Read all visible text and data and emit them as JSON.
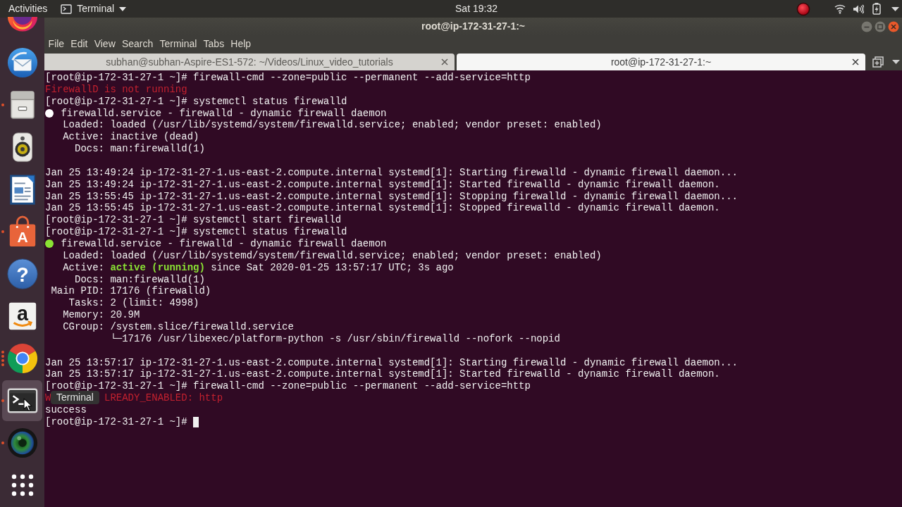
{
  "top_bar": {
    "activities": "Activities",
    "app_menu": "Terminal",
    "clock": "Sat 19:32"
  },
  "dock": {
    "items": [
      {
        "kind": "browser",
        "running": false,
        "hovered": false
      },
      {
        "kind": "mail",
        "running": false,
        "hovered": false
      },
      {
        "kind": "cabinet",
        "running": true,
        "several_windows": false,
        "hovered": false
      },
      {
        "kind": "speaker",
        "running": false,
        "hovered": false
      },
      {
        "kind": "document",
        "running": false,
        "hovered": false
      },
      {
        "kind": "bag",
        "glyph": "A",
        "running": true,
        "several_windows": false,
        "hovered": false
      },
      {
        "kind": "help",
        "glyph": "?",
        "running": false,
        "hovered": false
      },
      {
        "kind": "shop",
        "glyph": "a",
        "running": false,
        "hovered": false
      },
      {
        "kind": "wheel",
        "running": true,
        "several_windows": true,
        "hovered": false
      },
      {
        "kind": "terminal",
        "running": true,
        "several_windows": false,
        "hovered": true,
        "tooltip": "Terminal"
      },
      {
        "kind": "lens",
        "running": true,
        "several_windows": false,
        "hovered": false
      },
      {
        "kind": "grid",
        "running": false,
        "hovered": false
      }
    ]
  },
  "window": {
    "title": "root@ip-172-31-27-1:~",
    "menu": [
      "File",
      "Edit",
      "View",
      "Search",
      "Terminal",
      "Tabs",
      "Help"
    ],
    "tabs": [
      {
        "label": "subhan@subhan-Aspire-ES1-572: ~/Videos/Linux_video_tutorials",
        "selected": false
      },
      {
        "label": "root@ip-172-31-27-1:~",
        "selected": true
      }
    ]
  },
  "terminal": {
    "lines": [
      {
        "kind": "prompt",
        "text": "[root@ip-172-31-27-1 ~]# firewall-cmd --zone=public --permanent --add-service=http",
        "cursor": false
      },
      {
        "kind": "error",
        "parts": [
          "FirewallD is not running"
        ]
      },
      {
        "kind": "prompt",
        "text": "[root@ip-172-31-27-1 ~]# systemctl status firewalld",
        "cursor": false
      },
      {
        "kind": "unit",
        "color": "#ffffff",
        "text": "firewalld.service - firewalld - dynamic firewall daemon"
      },
      {
        "kind": "output",
        "text": "   Loaded: loaded (/usr/lib/systemd/system/firewalld.service; enabled; vendor preset: enabled)"
      },
      {
        "kind": "output",
        "text": "   Active: inactive (dead)"
      },
      {
        "kind": "output",
        "text": "     Docs: man:firewalld(1)"
      },
      {
        "kind": "blank"
      },
      {
        "kind": "output",
        "text": "Jan 25 13:49:24 ip-172-31-27-1.us-east-2.compute.internal systemd[1]: Starting firewalld - dynamic firewall daemon..."
      },
      {
        "kind": "output",
        "text": "Jan 25 13:49:24 ip-172-31-27-1.us-east-2.compute.internal systemd[1]: Started firewalld - dynamic firewall daemon."
      },
      {
        "kind": "output",
        "text": "Jan 25 13:55:45 ip-172-31-27-1.us-east-2.compute.internal systemd[1]: Stopping firewalld - dynamic firewall daemon..."
      },
      {
        "kind": "output",
        "text": "Jan 25 13:55:45 ip-172-31-27-1.us-east-2.compute.internal systemd[1]: Stopped firewalld - dynamic firewall daemon."
      },
      {
        "kind": "prompt",
        "text": "[root@ip-172-31-27-1 ~]# systemctl start firewalld",
        "cursor": false
      },
      {
        "kind": "prompt",
        "text": "[root@ip-172-31-27-1 ~]# systemctl status firewalld",
        "cursor": false
      },
      {
        "kind": "unit",
        "color": "#8ae234",
        "text": "firewalld.service - firewalld - dynamic firewall daemon"
      },
      {
        "kind": "output",
        "text": "   Loaded: loaded (/usr/lib/systemd/system/firewalld.service; enabled; vendor preset: enabled)"
      },
      {
        "kind": "output",
        "text": "   Active: **active (running)** since Sat 2020-01-25 13:57:17 UTC; 3s ago"
      },
      {
        "kind": "output",
        "text": "     Docs: man:firewalld(1)"
      },
      {
        "kind": "output",
        "text": " Main PID: 17176 (firewalld)"
      },
      {
        "kind": "output",
        "text": "    Tasks: 2 (limit: 4998)"
      },
      {
        "kind": "output",
        "text": "   Memory: 20.9M"
      },
      {
        "kind": "output",
        "text": "   CGroup: /system.slice/firewalld.service"
      },
      {
        "kind": "output",
        "text": "           └─17176 /usr/libexec/platform-python -s /usr/sbin/firewalld --nofork --nopid"
      },
      {
        "kind": "blank"
      },
      {
        "kind": "output",
        "text": "Jan 25 13:57:17 ip-172-31-27-1.us-east-2.compute.internal systemd[1]: Starting firewalld - dynamic firewall daemon..."
      },
      {
        "kind": "output",
        "text": "Jan 25 13:57:17 ip-172-31-27-1.us-east-2.compute.internal systemd[1]: Started firewalld - dynamic firewall daemon."
      },
      {
        "kind": "prompt",
        "text": "[root@ip-172-31-27-1 ~]# firewall-cmd --zone=public --permanent --add-service=http",
        "cursor": false
      },
      {
        "kind": "error",
        "parts": [
          "W",
          "LREADY_ENABLED: http"
        ]
      },
      {
        "kind": "output",
        "text": "success"
      },
      {
        "kind": "prompt",
        "text": "[root@ip-172-31-27-1 ~]#",
        "cursor": true
      }
    ]
  }
}
